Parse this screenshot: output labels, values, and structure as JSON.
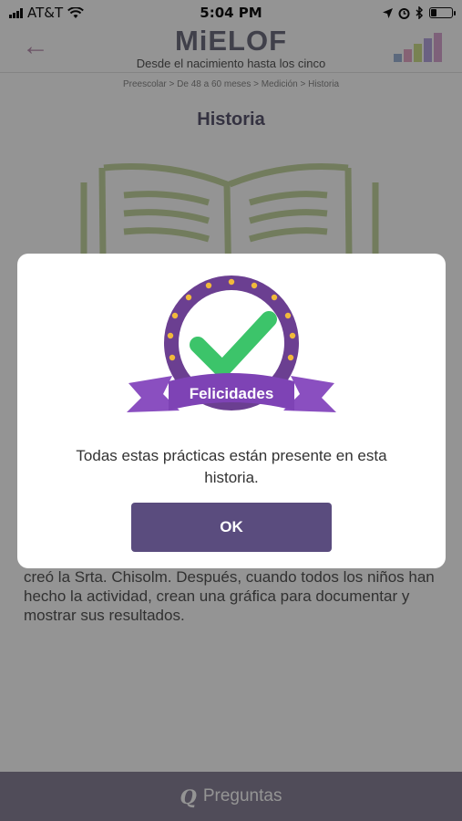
{
  "status_bar": {
    "carrier": "AT&T",
    "time": "5:04 PM",
    "battery_level": 0.25
  },
  "header": {
    "logo": "MiELOF",
    "tagline": "Desde el nacimiento hasta los cinco",
    "back_icon": "arrow-left-icon",
    "chart_icon": "bar-chart-icon"
  },
  "breadcrumb": "Preescolar > De 48 a 60 meses > Medición > Historia",
  "page_title": "Historia",
  "story": {
    "text": "creó la Srta. Chisolm. Después, cuando todos los niños han hecho la actividad, crean una gráfica para documentar y mostrar sus resultados."
  },
  "modal": {
    "badge_label": "Felicidades",
    "message": "Todas estas prácticas están presente en esta historia.",
    "ok_label": "OK"
  },
  "footer": {
    "icon": "Q",
    "label": "Preguntas"
  },
  "colors": {
    "accent_purple": "#5a4c7e",
    "badge_purple": "#6b3f91",
    "ribbon_purple": "#8a4fc0",
    "check_green": "#3cc46a",
    "book_green": "#c5d6a0",
    "footer_bg": "#8a8399"
  }
}
